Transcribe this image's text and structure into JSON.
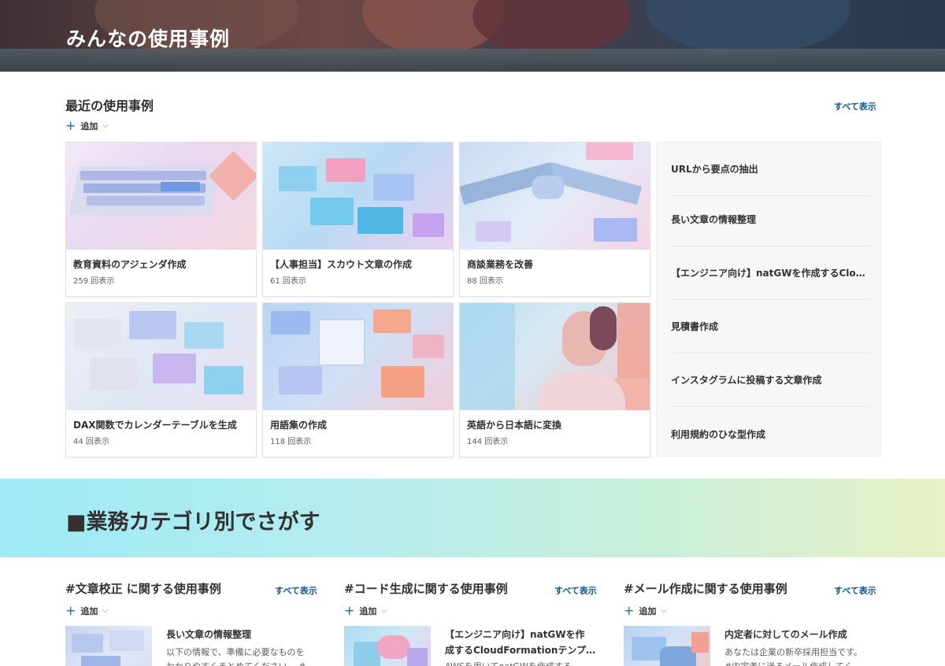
{
  "hero": {
    "title": "みんなの使用事例"
  },
  "recent": {
    "title": "最近の使用事例",
    "see_all": "すべて表示",
    "add_label": "追加",
    "cards": [
      {
        "title": "教育資料のアジェンダ作成",
        "views": "259 回表示"
      },
      {
        "title": "【人事担当】スカウト文章の作成",
        "views": "61 回表示"
      },
      {
        "title": "商談業務を改善",
        "views": "88 回表示"
      },
      {
        "title": "DAX関数でカレンダーテーブルを生成",
        "views": "44 回表示"
      },
      {
        "title": "用語集の作成",
        "views": "118 回表示"
      },
      {
        "title": "英語から日本語に変換",
        "views": "144 回表示"
      }
    ],
    "list": [
      "URLから要点の抽出",
      "長い文章の情報整理",
      "【エンジニア向け】natGWを作成するCloudFormationテンプレート",
      "見積書作成",
      "インスタグラムに投稿する文章作成",
      "利用規約のひな型作成"
    ]
  },
  "banner": {
    "title": "■業務カテゴリ別でさがす"
  },
  "categories": [
    {
      "title": "#文章校正 に関する使用事例",
      "see_all": "すべて表示",
      "add_label": "追加",
      "item": {
        "title": "長い文章の情報整理",
        "desc1": "以下の情報で、準備に必要なものを",
        "desc2": "わかりやすくまとめてください。 #"
      }
    },
    {
      "title": "#コード生成に関する使用事例",
      "see_all": "すべて表示",
      "add_label": "追加",
      "item": {
        "title1": "【エンジニア向け】natGWを作",
        "title2": "成するCloudFormationテンプ…",
        "desc1": "AWSを用いてnatGWを作成する"
      }
    },
    {
      "title": "#メール作成に関する使用事例",
      "see_all": "すべて表示",
      "add_label": "追加",
      "item": {
        "title": "内定者に対してのメール作成",
        "desc1": "あなたは企業の新卒採用担当です。",
        "desc2": "#内定者に送るメール作成してく"
      }
    }
  ],
  "colors": {
    "link": "#0f548c",
    "accent": "#0f6cbd"
  },
  "icons": {
    "add": "plus-icon",
    "dropdown": "chevron-down-icon"
  }
}
